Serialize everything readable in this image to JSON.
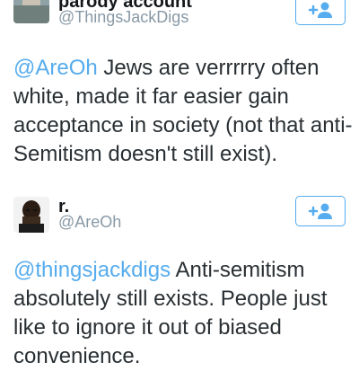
{
  "tweets": [
    {
      "display_name": "parody account",
      "handle": "@ThingsJackDigs",
      "mention": "@AreOh",
      "text": " Jews are verrrrry often white, made it far easier gain acceptance in society (not that anti-Semitism doesn't still exist).",
      "follow_icon": "add-user-icon"
    },
    {
      "display_name": "r.",
      "handle": "@AreOh",
      "mention": "@thingsjackdigs",
      "text": " Anti-semitism absolutely still exists. People just like to ignore it out of biased convenience.",
      "follow_icon": "add-user-icon"
    }
  ],
  "colors": {
    "accent": "#55acee",
    "text": "#292f33",
    "secondary": "#8899a6"
  }
}
